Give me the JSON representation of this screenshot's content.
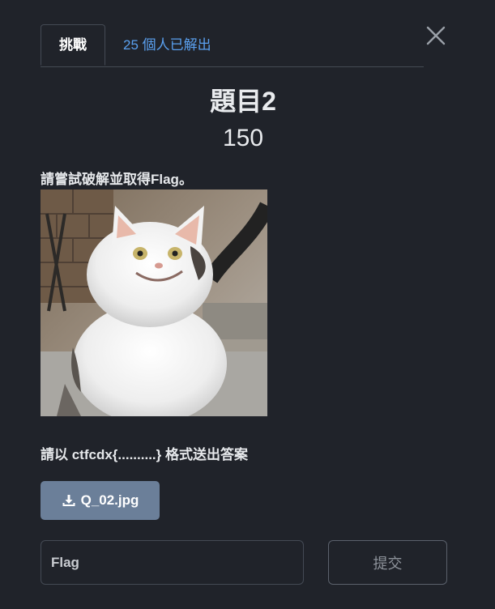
{
  "tabs": {
    "challenge_label": "挑戰",
    "solves_label": "25 個人已解出"
  },
  "challenge": {
    "title": "題目2",
    "points": "150",
    "description": "請嘗試破解並取得Flag。",
    "image_icon": "cat-photo",
    "hint": "請以 ctfcdx{..........} 格式送出答案"
  },
  "file": {
    "label": "Q_02.jpg",
    "icon": "download-icon"
  },
  "submission": {
    "placeholder": "Flag",
    "value": "",
    "submit_label": "提交"
  },
  "colors": {
    "background": "#20232a",
    "tab_link": "#5aa0ef",
    "file_button": "#6b7f99"
  }
}
